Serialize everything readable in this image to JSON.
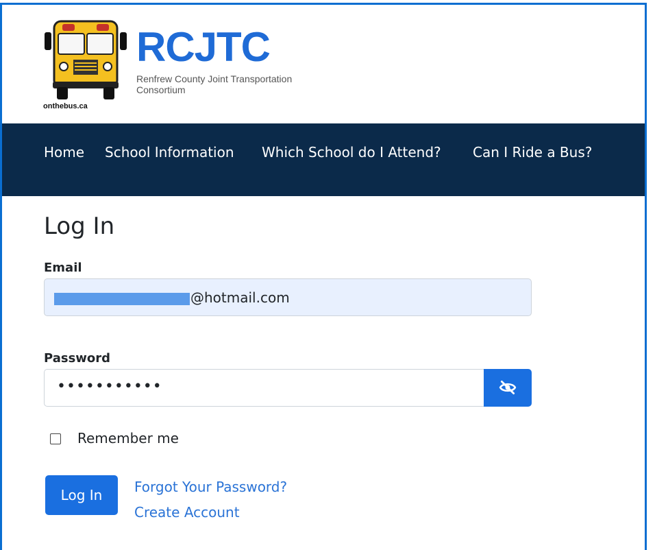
{
  "brand": {
    "title": "RCJTC",
    "subtitle": "Renfrew County Joint Transportation Consortium",
    "bus_caption": "onthebus.ca"
  },
  "nav": {
    "items": [
      "Home",
      "School Information",
      "Which School do I Attend?",
      "Can I Ride a Bus?"
    ]
  },
  "login": {
    "title": "Log In",
    "email_label": "Email",
    "email_value_suffix": "@hotmail.com",
    "password_label": "Password",
    "password_mask": "•••••••••••",
    "show_password_icon": "eye-slash-icon",
    "remember_label": "Remember me",
    "remember_checked": false,
    "submit_label": "Log In",
    "forgot_link": "Forgot Your Password?",
    "create_link": "Create Account"
  },
  "colors": {
    "nav_bg": "#0b2a4a",
    "primary": "#1a6fe0",
    "brand_blue": "#1f6bd6",
    "email_autofill_bg": "#e8f0fe",
    "link": "#2a73d6",
    "bus_yellow": "#f4c020",
    "frame_border": "#0a6ed1"
  }
}
